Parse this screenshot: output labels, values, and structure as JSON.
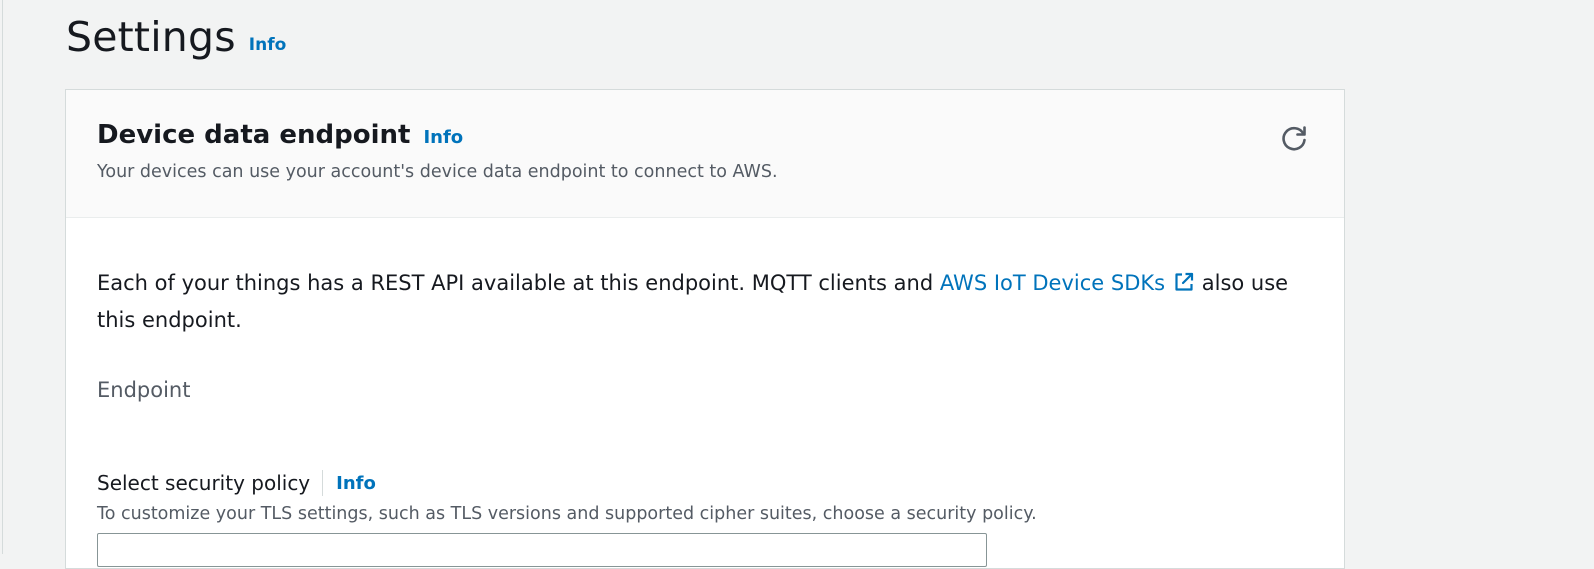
{
  "page": {
    "title": "Settings",
    "info_label": "Info"
  },
  "endpoint_panel": {
    "title": "Device data endpoint",
    "info_label": "Info",
    "description": "Your devices can use your account's device data endpoint to connect to AWS.",
    "refresh_icon": "refresh-icon",
    "body_text_before": "Each of your things has a REST API available at this endpoint. MQTT clients and ",
    "body_link": "AWS IoT Device SDKs",
    "body_link_icon": "external-link-icon",
    "body_text_after": " also use this endpoint.",
    "endpoint_label": "Endpoint"
  },
  "security_policy": {
    "label": "Select security policy",
    "info_label": "Info",
    "description": "To customize your TLS settings, such as TLS versions and supported cipher suites, choose a security policy."
  },
  "colors": {
    "background": "#f2f3f3",
    "link": "#0073bb",
    "text": "#16191f",
    "secondary_text": "#545b64"
  }
}
